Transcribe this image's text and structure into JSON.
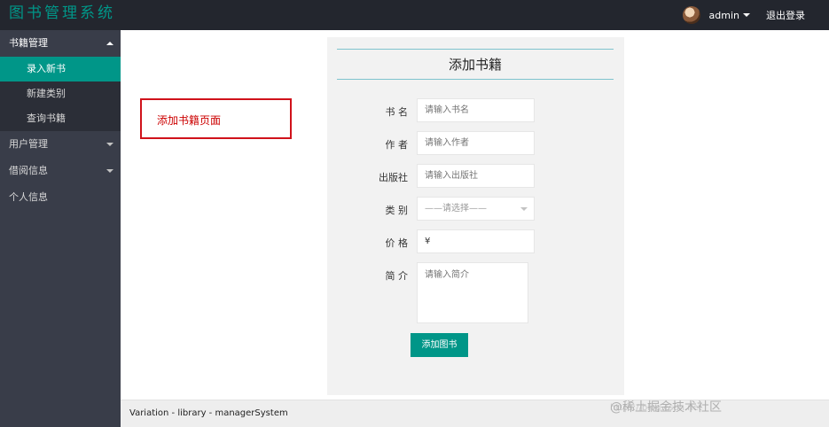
{
  "header": {
    "logo": "图书管理系统",
    "username": "admin",
    "logout": "退出登录"
  },
  "sidebar": {
    "groups": [
      {
        "label": "书籍管理",
        "items": [
          "录入新书",
          "新建类别",
          "查询书籍"
        ],
        "active_item": "录入新书"
      },
      {
        "label": "用户管理"
      },
      {
        "label": "借阅信息"
      },
      {
        "label": "个人信息"
      }
    ]
  },
  "annotation": {
    "text": "添加书籍页面"
  },
  "form": {
    "title": "添加书籍",
    "fields": [
      {
        "label": "书 名",
        "placeholder": "请输入书名"
      },
      {
        "label": "作 者",
        "placeholder": "请输入作者"
      },
      {
        "label": "出版社",
        "placeholder": "请输入出版社"
      },
      {
        "label": "类 别",
        "selected": "——请选择——"
      },
      {
        "label": "价 格",
        "value": "¥"
      },
      {
        "label": "简 介",
        "placeholder": "请输入简介"
      }
    ],
    "submit": "添加图书"
  },
  "footer": {
    "text": "Variation - library - managerSystem"
  },
  "watermark": {
    "text": "@稀土掘金技术社区",
    "url": "https://blog.csdn.net"
  },
  "colors": {
    "accent": "#009688",
    "header_bg": "#23262e",
    "sidebar_bg": "#393d49",
    "annotation": "#d0121b"
  }
}
